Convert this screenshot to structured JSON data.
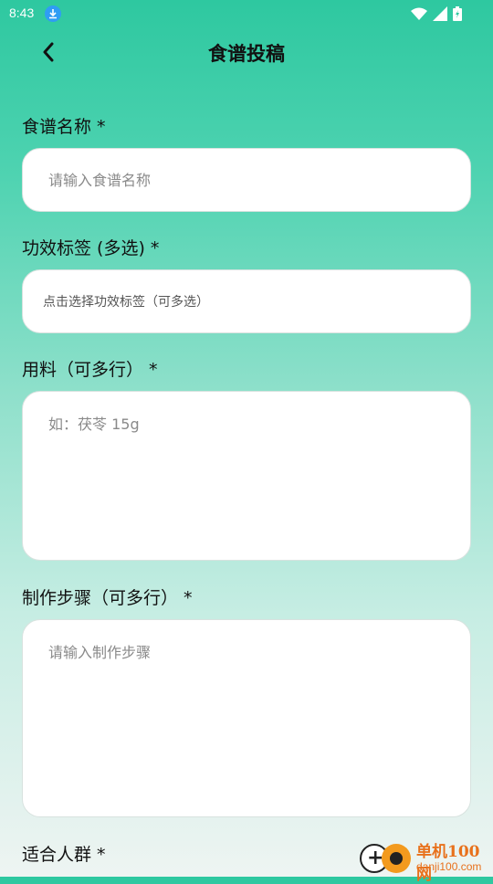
{
  "status": {
    "time": "8:43"
  },
  "header": {
    "title": "食谱投稿"
  },
  "form": {
    "name": {
      "label": "食谱名称 *",
      "placeholder": "请输入食谱名称"
    },
    "tags": {
      "label": "功效标签 (多选) *",
      "placeholder": "点击选择功效标签（可多选）"
    },
    "ingredients": {
      "label": "用料（可多行） *",
      "placeholder": "如：茯苓 15g"
    },
    "steps": {
      "label": "制作步骤（可多行） *",
      "placeholder": "请输入制作步骤"
    },
    "audience": {
      "label": "适合人群 *"
    }
  },
  "watermark": {
    "name": "单机100网",
    "domain": "danji100.com"
  },
  "colors": {
    "gradient_top": "#2ec8a0",
    "gradient_bottom": "#eef4f2",
    "field_bg": "#ffffff"
  }
}
